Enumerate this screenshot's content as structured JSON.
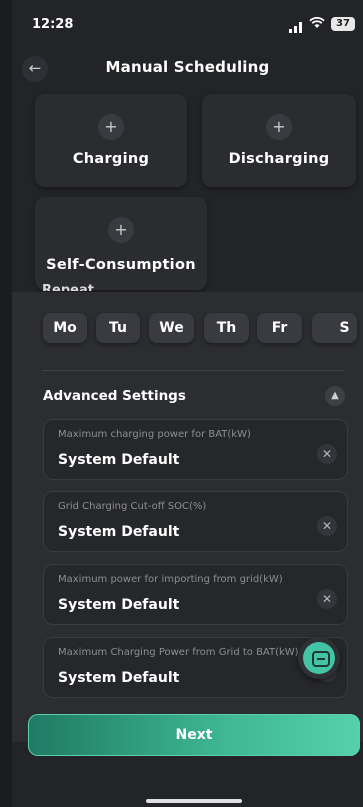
{
  "status_bar": {
    "time": "12:28",
    "battery": "37"
  },
  "header": {
    "title": "Manual Scheduling"
  },
  "modes": [
    {
      "label": "Charging"
    },
    {
      "label": "Discharging"
    },
    {
      "label": "Self-Consumption"
    }
  ],
  "repeat": {
    "label": "Repeat"
  },
  "days": [
    "Mo",
    "Tu",
    "We",
    "Th",
    "Fr",
    "S"
  ],
  "advanced": {
    "title": "Advanced Settings",
    "fields": [
      {
        "label": "Maximum charging power for BAT(kW)",
        "value": "System Default"
      },
      {
        "label": "Grid Charging Cut-off SOC(%)",
        "value": "System Default"
      },
      {
        "label": "Maximum power for importing from grid(kW)",
        "value": "System Default"
      },
      {
        "label": "Maximum Charging Power from Grid to BAT(kW)",
        "value": "System Default"
      }
    ]
  },
  "actions": {
    "next_label": "Next"
  }
}
